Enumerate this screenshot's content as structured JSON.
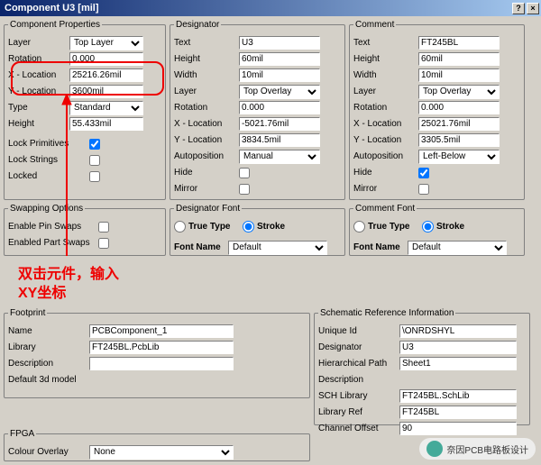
{
  "window": {
    "title": "Component U3 [mil]",
    "help": "?",
    "close": "×"
  },
  "cp": {
    "legend": "Component Properties",
    "layer_l": "Layer",
    "layer": "Top Layer",
    "rot_l": "Rotation",
    "rot": "0.000",
    "xloc_l": "X - Location",
    "xloc": "25216.26mil",
    "yloc_l": "Y - Location",
    "yloc": "3600mil",
    "type_l": "Type",
    "type": "Standard",
    "height_l": "Height",
    "height": "55.433mil",
    "lockp_l": "Lock Primitives",
    "locks_l": "Lock Strings",
    "locked_l": "Locked"
  },
  "des": {
    "legend": "Designator",
    "text_l": "Text",
    "text": "U3",
    "height_l": "Height",
    "height": "60mil",
    "width_l": "Width",
    "width": "10mil",
    "layer_l": "Layer",
    "layer": "Top Overlay",
    "rot_l": "Rotation",
    "rot": "0.000",
    "xloc_l": "X - Location",
    "xloc": "-5021.76mil",
    "yloc_l": "Y - Location",
    "yloc": "3834.5mil",
    "auto_l": "Autoposition",
    "auto": "Manual",
    "hide_l": "Hide",
    "mirror_l": "Mirror"
  },
  "com": {
    "legend": "Comment",
    "text_l": "Text",
    "text": "FT245BL",
    "height_l": "Height",
    "height": "60mil",
    "width_l": "Width",
    "width": "10mil",
    "layer_l": "Layer",
    "layer": "Top Overlay",
    "rot_l": "Rotation",
    "rot": "0.000",
    "xloc_l": "X - Location",
    "xloc": "25021.76mil",
    "yloc_l": "Y - Location",
    "yloc": "3305.5mil",
    "auto_l": "Autoposition",
    "auto": "Left-Below",
    "hide_l": "Hide",
    "mirror_l": "Mirror"
  },
  "swp": {
    "legend": "Swapping Options",
    "pin_l": "Enable Pin Swaps",
    "part_l": "Enabled Part Swaps"
  },
  "dfont": {
    "legend": "Designator Font",
    "tt": "True Type",
    "stroke": "Stroke",
    "name_l": "Font Name",
    "name": "Default"
  },
  "cfont": {
    "legend": "Comment Font",
    "tt": "True Type",
    "stroke": "Stroke",
    "name_l": "Font Name",
    "name": "Default"
  },
  "fp": {
    "legend": "Footprint",
    "name_l": "Name",
    "name": "PCBComponent_1",
    "lib_l": "Library",
    "lib": "FT245BL.PcbLib",
    "desc_l": "Description",
    "d3_l": "Default 3d model"
  },
  "sri": {
    "legend": "Schematic Reference Information",
    "uid_l": "Unique Id",
    "uid": "\\ONRDSHYL",
    "des_l": "Designator",
    "des": "U3",
    "hp_l": "Hierarchical Path",
    "hp": "Sheet1",
    "desc_l": "Description",
    "schlib_l": "SCH Library",
    "schlib": "FT245BL.SchLib",
    "libref_l": "Library Ref",
    "libref": "FT245BL",
    "co_l": "Channel Offset",
    "co": "90"
  },
  "fpga": {
    "legend": "FPGA",
    "co_l": "Colour Overlay",
    "co": "None"
  },
  "annotation": "双击元件，输入\nXY坐标",
  "watermark": "奈因PCB电路板设计"
}
